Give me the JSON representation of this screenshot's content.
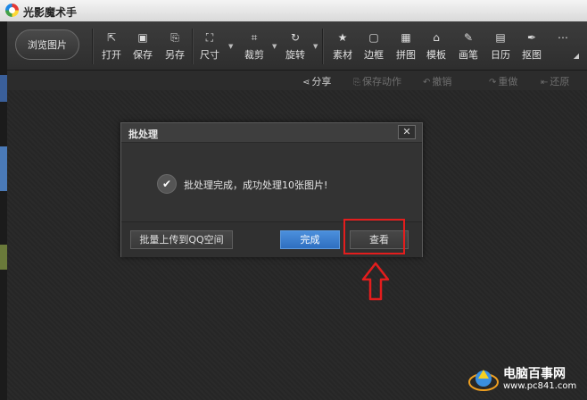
{
  "window": {
    "title": "光影魔术手"
  },
  "toolbar": {
    "browse_label": "浏览图片",
    "tools": [
      {
        "label": "打开",
        "icon": "open-icon"
      },
      {
        "label": "保存",
        "icon": "save-icon"
      },
      {
        "label": "另存",
        "icon": "save-as-icon"
      },
      {
        "label": "尺寸",
        "icon": "resize-icon"
      },
      {
        "label": "裁剪",
        "icon": "crop-icon"
      },
      {
        "label": "旋转",
        "icon": "rotate-icon"
      },
      {
        "label": "素材",
        "icon": "material-icon"
      },
      {
        "label": "边框",
        "icon": "border-icon"
      },
      {
        "label": "拼图",
        "icon": "collage-icon"
      },
      {
        "label": "模板",
        "icon": "template-icon"
      },
      {
        "label": "画笔",
        "icon": "brush-icon"
      },
      {
        "label": "日历",
        "icon": "calendar-icon"
      },
      {
        "label": "抠图",
        "icon": "cutout-icon"
      },
      {
        "label": "",
        "icon": "more-icon"
      }
    ]
  },
  "actionbar": {
    "share": "分享",
    "save_action": "保存动作",
    "undo": "撤销",
    "redo": "重做",
    "restore": "还原"
  },
  "dialog": {
    "title": "批处理",
    "message": "批处理完成，成功处理10张图片!",
    "upload_qq": "批量上传到QQ空间",
    "done": "完成",
    "view": "查看",
    "close_glyph": "✕"
  },
  "watermark": {
    "name": "电脑百事网",
    "url": "www.pc841.com"
  },
  "colors": {
    "accent_blue": "#3a7fd0",
    "annotation_red": "#e31d1d"
  }
}
